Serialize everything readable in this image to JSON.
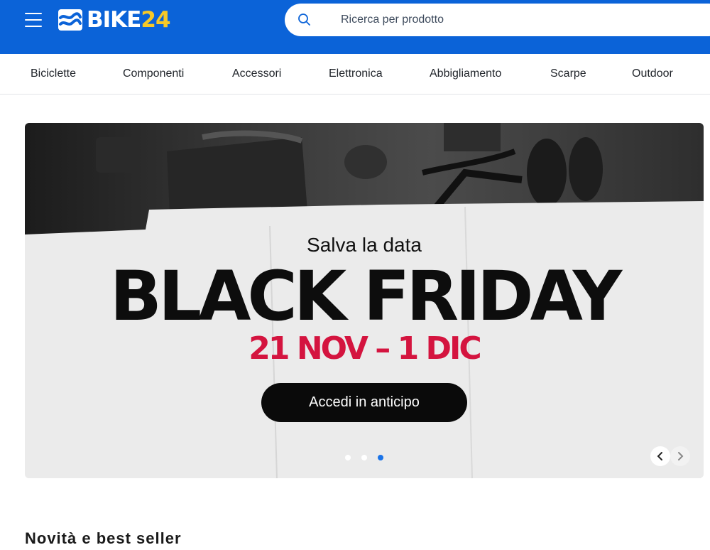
{
  "header": {
    "logo_text_white": "BIKE",
    "logo_text_yellow": "24",
    "search_placeholder": "Ricerca per prodotto",
    "colors": {
      "bar": "#0b63d8",
      "logo_accent": "#f7c927"
    }
  },
  "nav": {
    "items": [
      "Biciclette",
      "Componenti",
      "Accessori",
      "Elettronica",
      "Abbigliamento",
      "Scarpe",
      "Outdoor"
    ]
  },
  "hero": {
    "kicker": "Salva la data",
    "title": "BLACK FRIDAY",
    "dates": "21 NOV – 1 DIC",
    "cta_label": "Accedi in anticipo",
    "slides_total": 3,
    "active_slide": 3,
    "colors": {
      "dates": "#d4143f",
      "cta": "#0a0a0a",
      "active_dot": "#1a73e8"
    }
  },
  "sections": {
    "new_bestsellers_title": "Novità e best seller"
  }
}
